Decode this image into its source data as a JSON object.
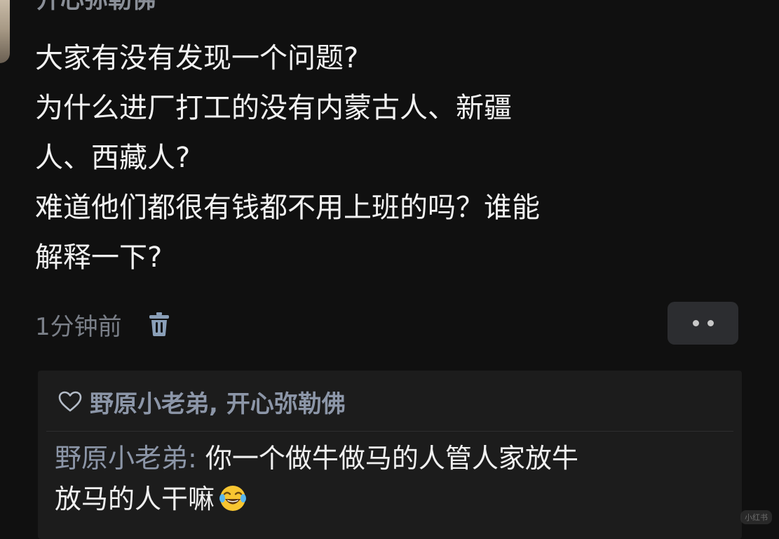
{
  "post": {
    "author": "开心弥勒佛",
    "content_lines": [
      "大家有没有发现一个问题?",
      "为什么进厂打工的没有内蒙古人、新疆",
      "人、西藏人?",
      "难道他们都很有钱都不用上班的吗？谁能",
      "解释一下?"
    ],
    "time": "1分钟前",
    "icons": {
      "delete": "trash-icon",
      "more": "more-dots-icon"
    }
  },
  "reactions": {
    "heart_icon": "heart-outline-icon",
    "likers": "野原小老弟, 开心弥勒佛"
  },
  "comment": {
    "author": "野原小老弟",
    "separator": ": ",
    "line1": "你一个做牛做马的人管人家放牛",
    "line2": "放马的人干嘛",
    "emoji": "laughing-tears-emoji"
  },
  "watermark": "小红书",
  "colors": {
    "background": "#101010",
    "text": "#f2f2f2",
    "muted": "#7a7f88",
    "name_link": "#8c96a8",
    "reply_bg": "#1c1c1c"
  }
}
